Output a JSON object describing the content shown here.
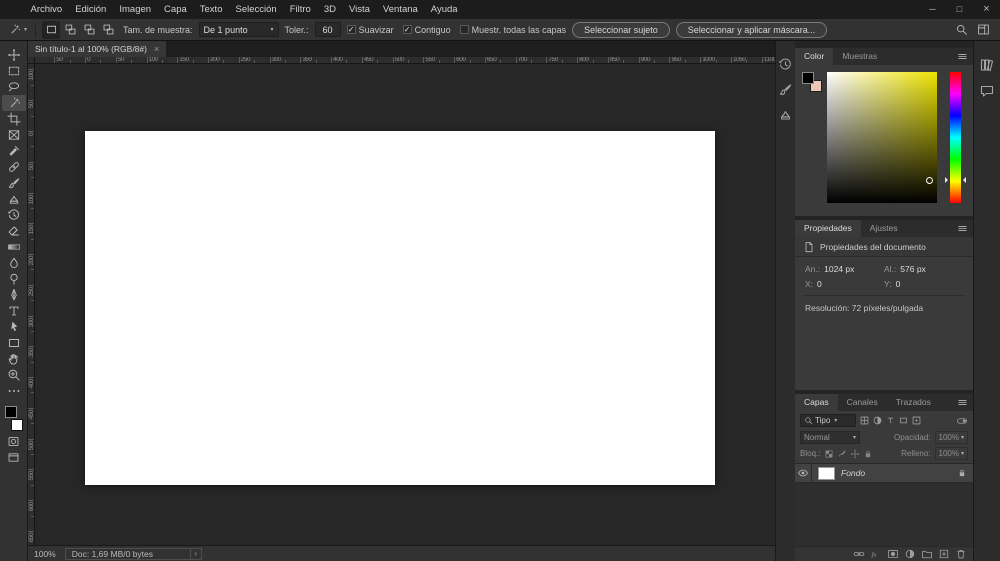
{
  "window": {
    "menu_items": [
      "Archivo",
      "Edición",
      "Imagen",
      "Capa",
      "Texto",
      "Selección",
      "Filtro",
      "3D",
      "Vista",
      "Ventana",
      "Ayuda"
    ],
    "controls": [
      {
        "name": "minimize-button",
        "glyph": "─"
      },
      {
        "name": "maximize-button",
        "glyph": "□"
      },
      {
        "name": "close-button",
        "glyph": "×"
      }
    ]
  },
  "options_bar": {
    "tool_icon": "magic-wand-tool",
    "mode_icons": [
      "new-selection-icon",
      "add-selection-icon",
      "subtract-selection-icon",
      "intersect-selection-icon"
    ],
    "sample_size_label": "Tam. de muestra:",
    "sample_size_value": "De 1 punto",
    "tolerance_label": "Toler.:",
    "tolerance_value": "60",
    "checkboxes": [
      {
        "label": "Suavizar",
        "checked": true
      },
      {
        "label": "Contiguo",
        "checked": true
      },
      {
        "label": "Muestr. todas las capas",
        "checked": false
      }
    ],
    "select_subject_button": "Seleccionar sujeto",
    "select_and_mask_button": "Seleccionar y aplicar máscara...",
    "right_icons": [
      "search-icon",
      "workspace-icon"
    ]
  },
  "tools": [
    {
      "name": "move-tool"
    },
    {
      "name": "rectangular-marquee-tool"
    },
    {
      "name": "lasso-tool"
    },
    {
      "name": "magic-wand-tool",
      "selected": true
    },
    {
      "name": "crop-tool"
    },
    {
      "name": "frame-tool"
    },
    {
      "name": "eyedropper-tool"
    },
    {
      "name": "spot-healing-brush-tool"
    },
    {
      "name": "brush-tool"
    },
    {
      "name": "clone-stamp-tool"
    },
    {
      "name": "history-brush-tool"
    },
    {
      "name": "eraser-tool"
    },
    {
      "name": "gradient-tool"
    },
    {
      "name": "blur-tool"
    },
    {
      "name": "dodge-tool"
    },
    {
      "name": "pen-tool"
    },
    {
      "name": "type-tool"
    },
    {
      "name": "path-selection-tool"
    },
    {
      "name": "rectangle-tool"
    },
    {
      "name": "hand-tool"
    },
    {
      "name": "zoom-tool"
    },
    {
      "name": "edit-toolbar-icon"
    }
  ],
  "toolbar_colors": {
    "foreground": "#000000",
    "background": "#ffffff"
  },
  "document": {
    "tab_title": "Sin título-1 al 100% (RGB/8#)",
    "close_glyph": "×",
    "zoom": "100%",
    "doc_size": "Doc: 1,69 MB/0 bytes",
    "status_arrow": "›"
  },
  "rulers": {
    "step": 50,
    "scale": 0.6152,
    "h_origin": 57,
    "v_origin": 90,
    "h_min": -50,
    "h_max": 1100,
    "v_min": -100,
    "v_max": 650
  },
  "dock_left_icons": [
    "history-icon",
    "brushes-icon",
    "clone-source-icon"
  ],
  "dock_right_icons": [
    "libraries-icon",
    "comments-icon"
  ],
  "color_panel": {
    "tabs": [
      "Color",
      "Muestras"
    ],
    "foreground": "#000000",
    "background": "#eec8b6",
    "hue_gradient": "linear-gradient(to bottom,#f00,#f0f 16.6%,#00f 33.3%,#0ff 50%,#0f0 66.6%,#ff0 83.3%,#f00)",
    "marker_x": 0.9,
    "marker_y": 0.8,
    "hue_pos": 0.83
  },
  "properties_panel": {
    "tabs": [
      "Propiedades",
      "Ajustes"
    ],
    "header": "Propiedades del documento",
    "fields": [
      {
        "label": "An.:",
        "value": "1024 px"
      },
      {
        "label": "Al.:",
        "value": "576 px"
      },
      {
        "label": "X:",
        "value": "0"
      },
      {
        "label": "Y:",
        "value": "0"
      }
    ],
    "resolution": "Resolución: 72 píxeles/pulgada"
  },
  "layers_panel": {
    "tabs": [
      "Capas",
      "Canales",
      "Trazados"
    ],
    "filter_kind": "Tipo",
    "filter_icons": [
      "pixel-filter-icon",
      "adjustment-filter-icon",
      "type-filter-icon",
      "shape-filter-icon",
      "smart-object-filter-icon"
    ],
    "blend_mode": "Normal",
    "opacity_label": "Opacidad:",
    "opacity_value": "100%",
    "lock_label": "Bloq.:",
    "lock_icons": [
      "lock-transparent-icon",
      "lock-pixels-icon",
      "lock-position-icon",
      "lock-all-icon"
    ],
    "fill_label": "Relleno:",
    "fill_value": "100%",
    "layers": [
      {
        "name": "Fondo",
        "visible": true,
        "locked": true
      }
    ],
    "footer_icons": [
      "link-layers-icon",
      "layer-style-icon",
      "layer-mask-icon",
      "adjustment-layer-icon",
      "group-layers-icon",
      "new-layer-icon",
      "delete-layer-icon"
    ]
  }
}
